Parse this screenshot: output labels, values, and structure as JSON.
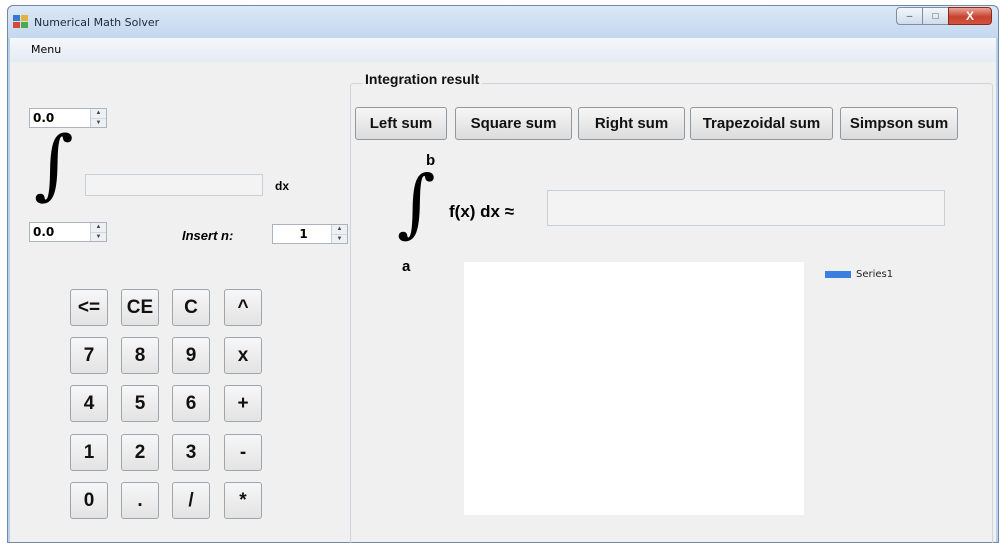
{
  "window": {
    "title": "Numerical Math Solver",
    "minimize_glyph": "–",
    "maximize_glyph": "□",
    "close_glyph": "X"
  },
  "menu": {
    "label": "Menu"
  },
  "left_panel": {
    "upper_limit_value": "0.0",
    "lower_limit_value": "0.0",
    "integral_glyph": "∫",
    "function_value": "",
    "dx_label": "dx",
    "insert_n_label": "Insert n:",
    "n_value": "1",
    "calculator_keys": [
      [
        "<=",
        "CE",
        "C",
        "^"
      ],
      [
        "7",
        "8",
        "9",
        "x"
      ],
      [
        "4",
        "5",
        "6",
        "+"
      ],
      [
        "1",
        "2",
        "3",
        "-"
      ],
      [
        "0",
        ".",
        "/",
        "*"
      ]
    ]
  },
  "integration": {
    "group_title": "Integration result",
    "buttons": [
      "Left sum",
      "Square sum",
      "Right sum",
      "Trapezoidal sum",
      "Simpson sum"
    ],
    "upper_label": "b",
    "lower_label": "a",
    "integral_glyph": "∫",
    "expression": "f(x) dx ≈",
    "result_value": ""
  },
  "chart": {
    "legend": [
      "Series1"
    ],
    "series_color": "#3a7fe0"
  },
  "chart_data": {
    "type": "line",
    "series": [
      {
        "name": "Series1",
        "values": []
      }
    ]
  }
}
